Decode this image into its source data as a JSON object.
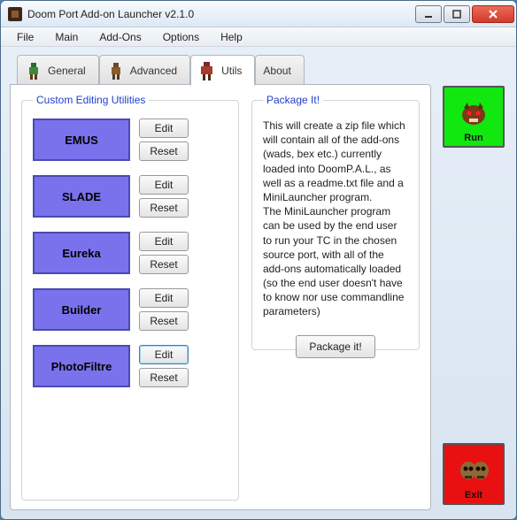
{
  "window": {
    "title": "Doom Port Add-on Launcher v2.1.0"
  },
  "menu": {
    "file": "File",
    "main": "Main",
    "addons": "Add-Ons",
    "options": "Options",
    "help": "Help"
  },
  "tabs": {
    "general": "General",
    "advanced": "Advanced",
    "utils": "Utils",
    "about": "About",
    "active": "utils"
  },
  "utils": {
    "legend": "Custom Editing Utilities",
    "items": [
      {
        "label": "EMUS"
      },
      {
        "label": "SLADE"
      },
      {
        "label": "Eureka"
      },
      {
        "label": "Builder"
      },
      {
        "label": "PhotoFiltre"
      }
    ],
    "edit_label": "Edit",
    "reset_label": "Reset"
  },
  "package": {
    "legend": "Package It!",
    "para1": "This will create a zip file which will contain all of the add-ons (wads, bex etc.) currently loaded into DoomP.A.L., as well as a readme.txt file and a MiniLauncher program.",
    "para2": "The MiniLauncher program can be used by the end user to run your TC in the chosen source port, with all of the add-ons automatically loaded (so the end user doesn't have to know nor use commandline parameters)",
    "button": "Package it!"
  },
  "side": {
    "run": "Run",
    "exit": "Exit"
  }
}
